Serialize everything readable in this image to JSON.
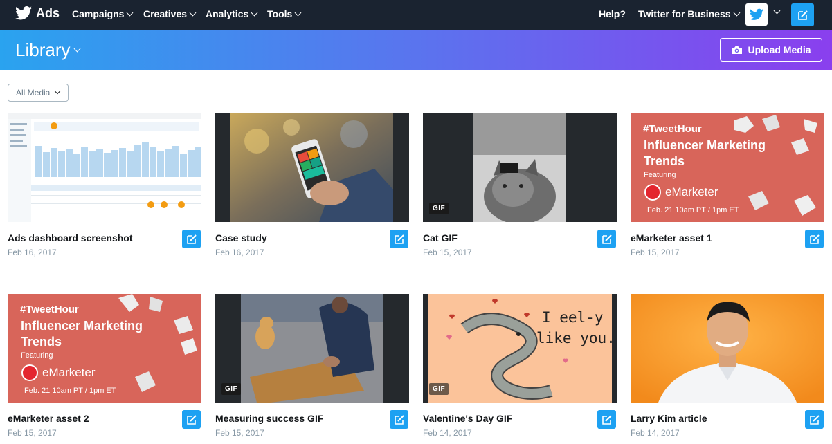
{
  "nav": {
    "brand": "Ads",
    "items": [
      {
        "label": "Campaigns"
      },
      {
        "label": "Creatives"
      },
      {
        "label": "Analytics"
      },
      {
        "label": "Tools"
      }
    ],
    "help": "Help?",
    "business": "Twitter for Business",
    "icons": {
      "logo": "twitter-bird-icon",
      "compose": "compose-icon",
      "avatar": "twitter-avatar-icon"
    }
  },
  "banner": {
    "title": "Library",
    "upload_label": "Upload Media",
    "gradient": [
      "#2aa3ef",
      "#8a3fee"
    ]
  },
  "filter": {
    "selected": "All Media"
  },
  "media": [
    {
      "title": "Ads dashboard screenshot",
      "date": "Feb 16, 2017",
      "kind": "image"
    },
    {
      "title": "Case study",
      "date": "Feb 16, 2017",
      "kind": "image"
    },
    {
      "title": "Cat GIF",
      "date": "Feb 15, 2017",
      "kind": "gif",
      "badge": "GIF"
    },
    {
      "title": "eMarketer asset 1",
      "date": "Feb 15, 2017",
      "kind": "image",
      "poster": {
        "hashtag": "#TweetHour",
        "line1": "Influencer Marketing",
        "line2": "Trends",
        "featuring": "Featuring",
        "brand": "eMarketer",
        "when": "Feb. 21 10am PT / 1pm ET"
      }
    },
    {
      "title": "eMarketer asset 2",
      "date": "Feb 15, 2017",
      "kind": "image",
      "poster": {
        "hashtag": "#TweetHour",
        "line1": "Influencer Marketing",
        "line2": "Trends",
        "featuring": "Featuring",
        "brand": "eMarketer",
        "when": "Feb. 21 10am PT / 1pm ET"
      }
    },
    {
      "title": "Measuring success GIF",
      "date": "Feb 15, 2017",
      "kind": "gif",
      "badge": "GIF"
    },
    {
      "title": "Valentine's Day GIF",
      "date": "Feb 14, 2017",
      "kind": "gif",
      "badge": "GIF",
      "art": {
        "line1": "I eel-y",
        "line2": "like you."
      }
    },
    {
      "title": "Larry Kim article",
      "date": "Feb 14, 2017",
      "kind": "image"
    }
  ],
  "colors": {
    "nav_bg": "#1a2330",
    "accent": "#1da1f2",
    "poster_bg": "#d8655a",
    "valentine_bg": "#fbc39a",
    "larry_bg": "#f7941d"
  }
}
